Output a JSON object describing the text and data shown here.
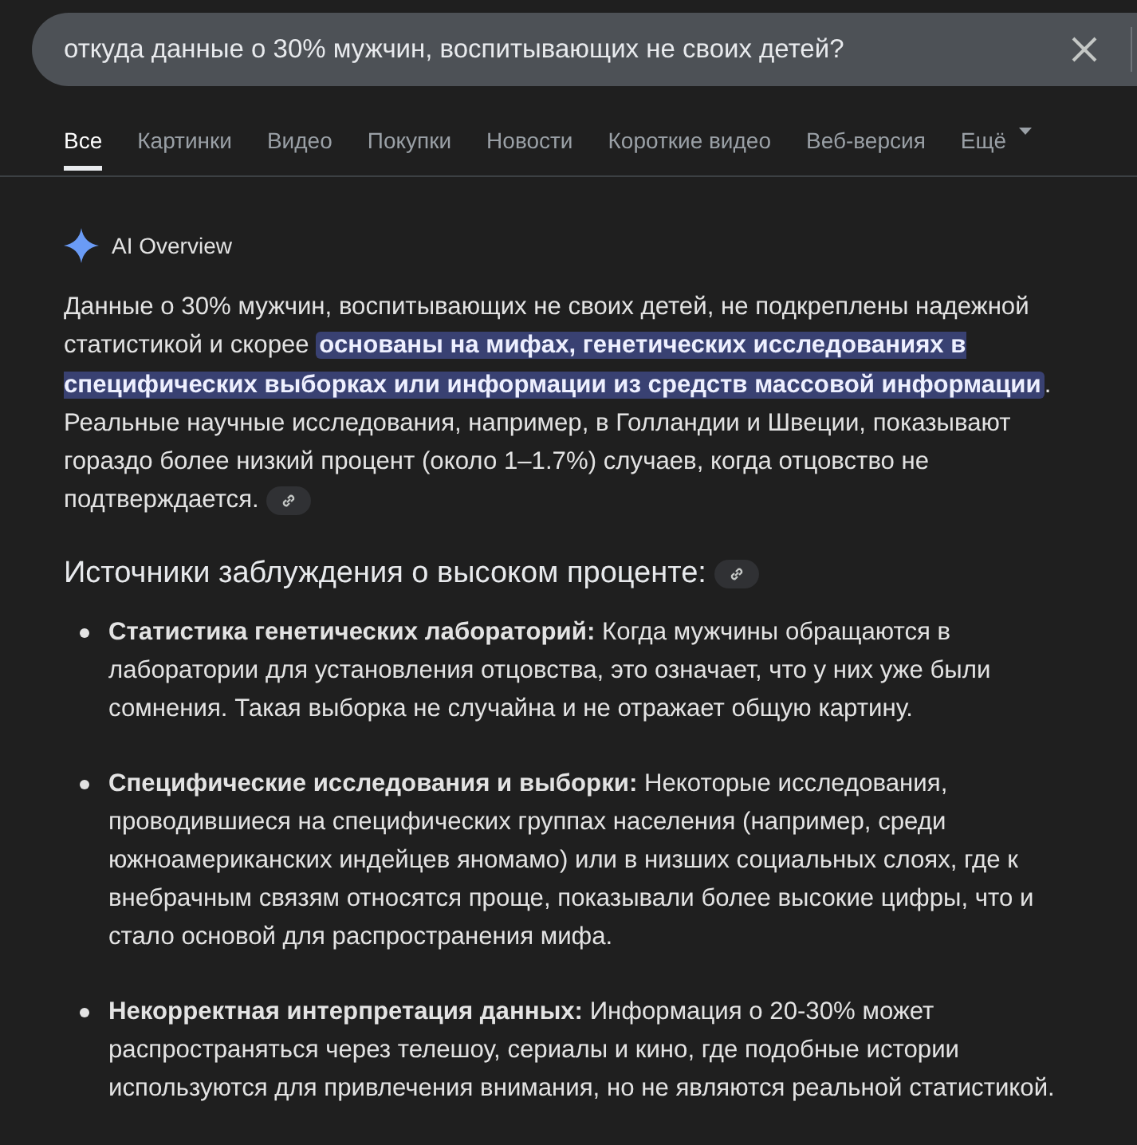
{
  "search": {
    "value": "откуда данные о 30% мужчин, воспитывающих не своих детей?"
  },
  "tabs": [
    {
      "label": "Все",
      "selected": true,
      "has_menu": false
    },
    {
      "label": "Картинки",
      "selected": false,
      "has_menu": false
    },
    {
      "label": "Видео",
      "selected": false,
      "has_menu": false
    },
    {
      "label": "Покупки",
      "selected": false,
      "has_menu": false
    },
    {
      "label": "Новости",
      "selected": false,
      "has_menu": false
    },
    {
      "label": "Короткие видео",
      "selected": false,
      "has_menu": false
    },
    {
      "label": "Веб-версия",
      "selected": false,
      "has_menu": false
    },
    {
      "label": "Ещё",
      "selected": false,
      "has_menu": true
    }
  ],
  "overview": {
    "title": "AI Overview",
    "summary": [
      {
        "text": "Данные о 30% мужчин, воспитывающих не своих детей, не подкреплены надежной статистикой и скорее ",
        "highlighted": false
      },
      {
        "text": "основаны на мифах, генетических исследованиях в специфических выборках или информации из средств массовой информации",
        "highlighted": true
      },
      {
        "text": ". Реальные научные исследования, например, в Голландии и Швеции, показывают гораздо более низкий процент (около 1–1.7%) случаев, когда отцовство не подтверждается.",
        "highlighted": false
      }
    ],
    "heading": "Источники заблуждения о высоком проценте:",
    "bullets": [
      "**Статистика генетических лабораторий:** Когда мужчины обращаются в лаборатории для установления отцовства, это означает, что у них уже были сомнения. Такая выборка не случайна и не отражает общую картину.",
      "**Специфические исследования и выборки:** Некоторые исследования, проводившиеся на специфических группах населения (например, среди южноамериканских индейцев яномамо) или в низших социальных слоях, где к внебрачным связям относятся проще, показывали более высокие цифры, что и стало основой для распространения мифа.",
      "**Некорректная интерпретация данных:** Информация о 20-30% может распространяться через телешоу, сериалы и кино, где подобные истории используются для привлечения внимания, но не являются реальной статистикой."
    ]
  }
}
